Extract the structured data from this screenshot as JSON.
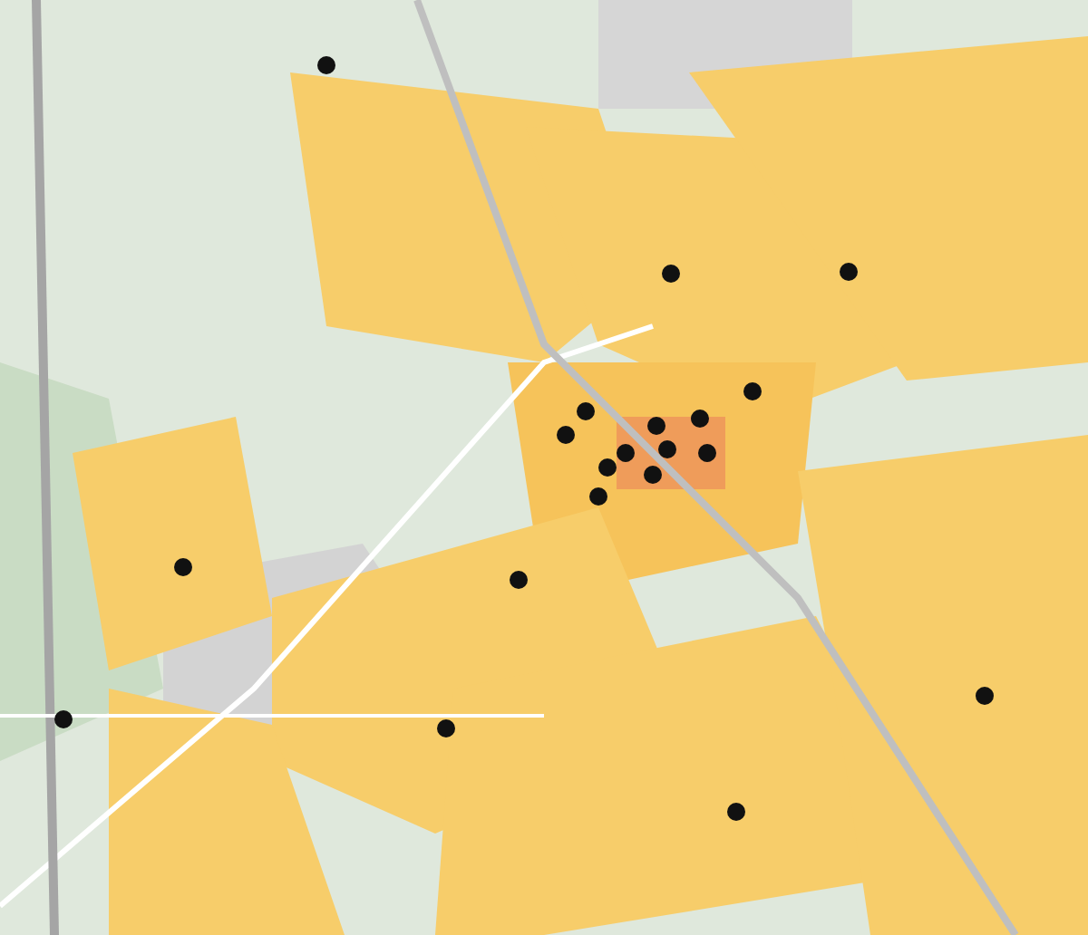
{
  "map": {
    "markers": [
      {
        "kind": "dot"
      },
      {
        "kind": "dot"
      },
      {
        "kind": "dot"
      },
      {
        "kind": "dot"
      },
      {
        "kind": "dot"
      },
      {
        "kind": "dot"
      },
      {
        "kind": "dot"
      },
      {
        "kind": "dot"
      },
      {
        "kind": "dot"
      },
      {
        "kind": "dot"
      },
      {
        "kind": "dot"
      },
      {
        "kind": "dot"
      },
      {
        "kind": "dot"
      },
      {
        "kind": "dot"
      },
      {
        "kind": "dot"
      },
      {
        "kind": "dot"
      },
      {
        "kind": "dot"
      },
      {
        "kind": "dot"
      },
      {
        "kind": "dot"
      },
      {
        "kind": "dot"
      }
    ]
  }
}
